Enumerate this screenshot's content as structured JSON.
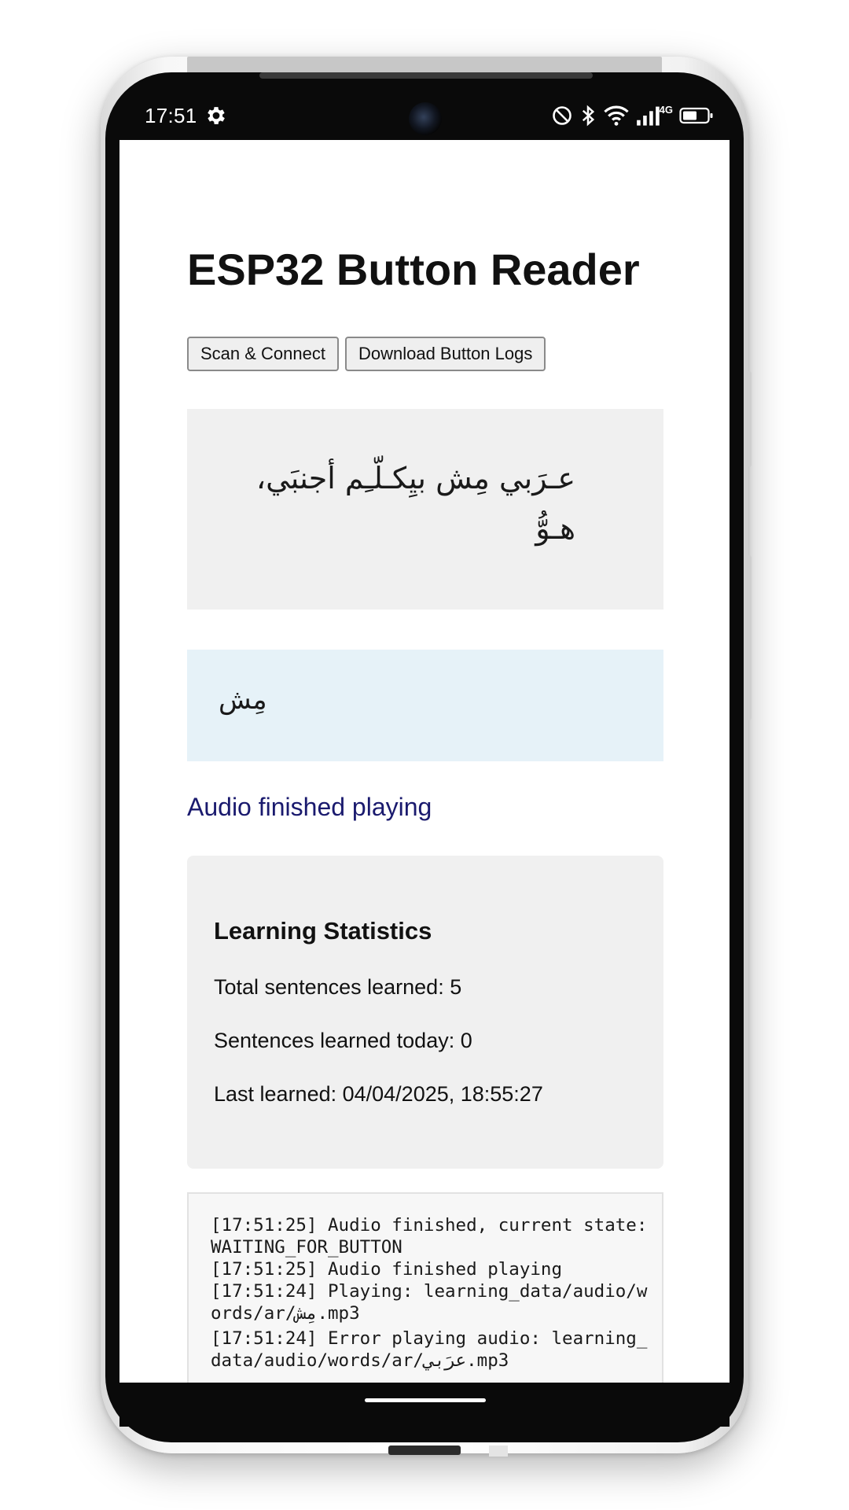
{
  "status_bar": {
    "time": "17:51",
    "network_label": "4G",
    "icons": [
      "gear-icon",
      "do-not-disturb-icon",
      "bluetooth-icon",
      "wifi-icon",
      "signal-icon",
      "battery-icon"
    ]
  },
  "app": {
    "title": "ESP32 Button Reader",
    "buttons": {
      "scan_label": "Scan & Connect",
      "download_label": "Download Button Logs"
    },
    "sentence": "عـرَبي مِش بيِكـلّـِم أجنبَي، هـوُّ",
    "current_word": "مِش",
    "status_message": "Audio finished playing",
    "stats": {
      "title": "Learning Statistics",
      "total": "Total sentences learned: 5",
      "today": "Sentences learned today: 0",
      "last": "Last learned: 04/04/2025, 18:55:27"
    },
    "log": [
      "[17:51:25] Audio finished, current state: WAITING_FOR_BUTTON",
      "[17:51:25] Audio finished playing",
      "[17:51:24] Playing: learning_data/audio/words/ar/مِش.mp3",
      "[17:51:24] Error playing audio: learning_data/audio/words/ar/عرَبي.mp3"
    ]
  },
  "colors": {
    "status_message": "#1a1a6e",
    "sentence_bg": "#f0f0f0",
    "word_bg": "#e6f2f8",
    "stats_bg": "#f0f0f0",
    "log_bg": "#f7f7f7"
  }
}
